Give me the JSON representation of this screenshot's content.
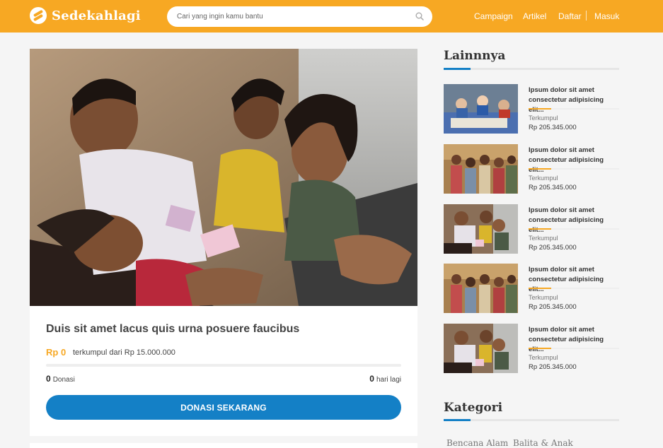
{
  "header": {
    "brand": "Sedekahlagi",
    "search_placeholder": "Cari yang ingin kamu bantu",
    "nav": [
      "Campaign",
      "Artikel",
      "Daftar",
      "Masuk"
    ]
  },
  "campaign": {
    "title": "Duis sit amet lacus quis urna posuere faucibus",
    "raised": "Rp 0",
    "raised_of": "terkumpul dari Rp 15.000.000",
    "progress": 0,
    "donors_count": "0",
    "donors_label": "Donasi",
    "days_count": "0",
    "days_label": "hari lagi",
    "button_label": "DONASI SEKARANG"
  },
  "sidebar": {
    "heading": "Lainnnya",
    "items": [
      {
        "title": "Ipsum dolor sit amet consectetur adipisicing elit...",
        "label": "Terkumpul",
        "amount": "Rp 205.345.000",
        "image": "classroom-photo"
      },
      {
        "title": "Ipsum dolor sit amet consectetur adipisicing elit...",
        "label": "Terkumpul",
        "amount": "Rp 205.345.000",
        "image": "children-group-photo"
      },
      {
        "title": "Ipsum dolor sit amet consectetur adipisicing elit...",
        "label": "Terkumpul",
        "amount": "Rp 205.345.000",
        "image": "children-reaching-photo"
      },
      {
        "title": "Ipsum dolor sit amet consectetur adipisicing elit...",
        "label": "Terkumpul",
        "amount": "Rp 205.345.000",
        "image": "children-group-photo"
      },
      {
        "title": "Ipsum dolor sit amet consectetur adipisicing elit...",
        "label": "Terkumpul",
        "amount": "Rp 205.345.000",
        "image": "children-reaching-photo"
      }
    ],
    "category_heading": "Kategori",
    "categories": [
      "Bencana Alam",
      "Balita & Anak"
    ]
  },
  "colors": {
    "brand": "#f7a823",
    "primary": "#1480c6"
  }
}
